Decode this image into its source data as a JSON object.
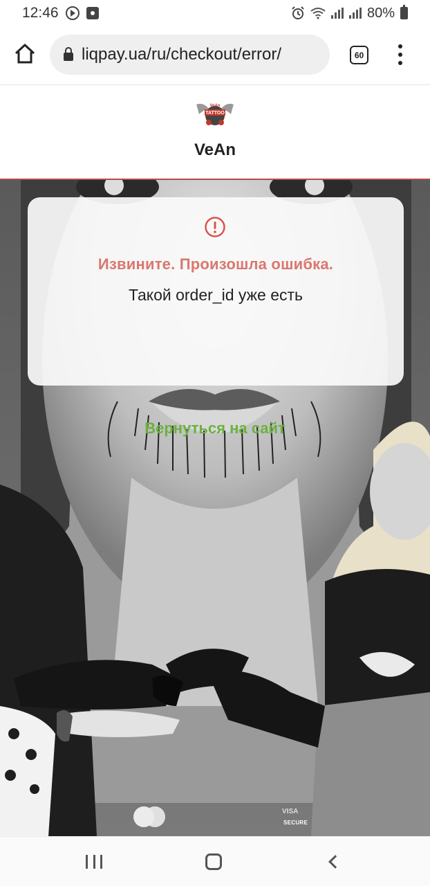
{
  "status_bar": {
    "time": "12:46",
    "battery": "80%",
    "icons": [
      "play-icon",
      "image-icon",
      "alarm-icon",
      "wifi-icon",
      "signal-icon",
      "battery-icon"
    ]
  },
  "browser": {
    "url": "liqpay.ua/ru/checkout/error/",
    "tab_count": "60",
    "icons": [
      "home-icon",
      "lock-icon",
      "menu-icon"
    ]
  },
  "merchant": {
    "name": "VeAn",
    "logo_text": [
      "VeAn",
      "TATTOO"
    ]
  },
  "error_card": {
    "title": "Извините. Произошла ошибка.",
    "message": "Такой order_id уже есть",
    "icon": "error-exclamation-icon",
    "title_color": "#d9776e"
  },
  "back_link": {
    "label": "Вернуться на сайт",
    "color": "#6ab23f"
  },
  "footer": {
    "card_brands": [
      "mastercard-icon",
      "visa-icon"
    ],
    "visa_text": "VISA",
    "secure_text": "SECURE"
  },
  "nav": {
    "icons": [
      "recent-apps-icon",
      "home-nav-icon",
      "back-icon"
    ]
  }
}
